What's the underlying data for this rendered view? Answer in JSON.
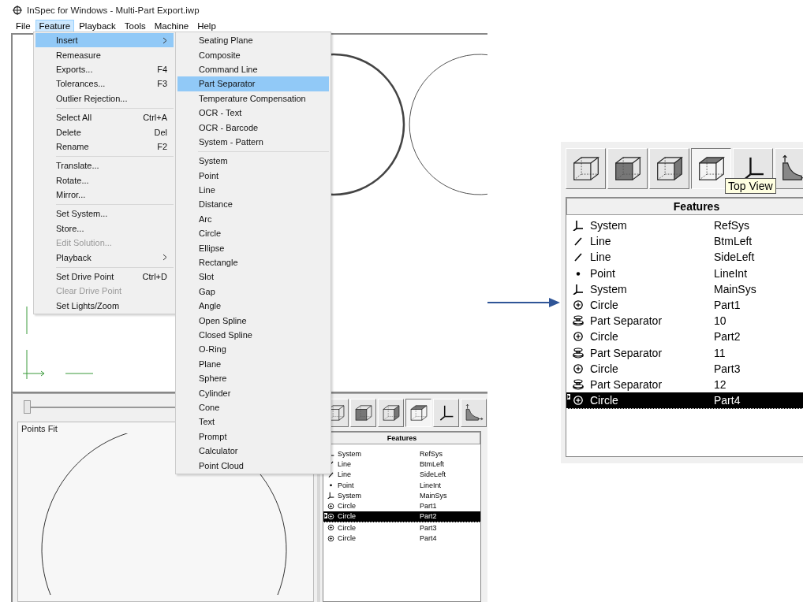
{
  "window": {
    "title": "InSpec for Windows - Multi-Part Export.iwp"
  },
  "menu_bar": [
    {
      "label": "File",
      "selected": false
    },
    {
      "label": "Feature",
      "selected": true
    },
    {
      "label": "Playback",
      "selected": false
    },
    {
      "label": "Tools",
      "selected": false
    },
    {
      "label": "Machine",
      "selected": false
    },
    {
      "label": "Help",
      "selected": false
    }
  ],
  "feature_menu": [
    {
      "kind": "item",
      "label": "Insert",
      "has_submenu": true,
      "selected": true,
      "disabled": false
    },
    {
      "kind": "item",
      "label": "Remeasure",
      "has_submenu": false,
      "selected": false,
      "disabled": false
    },
    {
      "kind": "item",
      "label": "Exports...",
      "shortcut": "F4",
      "has_submenu": false,
      "selected": false,
      "disabled": false
    },
    {
      "kind": "item",
      "label": "Tolerances...",
      "shortcut": "F3",
      "has_submenu": false,
      "selected": false,
      "disabled": false
    },
    {
      "kind": "item",
      "label": "Outlier Rejection...",
      "has_submenu": false,
      "selected": false,
      "disabled": false
    },
    {
      "kind": "separator"
    },
    {
      "kind": "item",
      "label": "Select All",
      "shortcut": "Ctrl+A",
      "has_submenu": false,
      "selected": false,
      "disabled": false
    },
    {
      "kind": "item",
      "label": "Delete",
      "shortcut": "Del",
      "has_submenu": false,
      "selected": false,
      "disabled": false
    },
    {
      "kind": "item",
      "label": "Rename",
      "shortcut": "F2",
      "has_submenu": false,
      "selected": false,
      "disabled": false
    },
    {
      "kind": "separator"
    },
    {
      "kind": "item",
      "label": "Translate...",
      "has_submenu": false,
      "selected": false,
      "disabled": false
    },
    {
      "kind": "item",
      "label": "Rotate...",
      "has_submenu": false,
      "selected": false,
      "disabled": false
    },
    {
      "kind": "item",
      "label": "Mirror...",
      "has_submenu": false,
      "selected": false,
      "disabled": false
    },
    {
      "kind": "separator"
    },
    {
      "kind": "item",
      "label": "Set System...",
      "has_submenu": false,
      "selected": false,
      "disabled": false
    },
    {
      "kind": "item",
      "label": "Store...",
      "has_submenu": false,
      "selected": false,
      "disabled": false
    },
    {
      "kind": "item",
      "label": "Edit Solution...",
      "has_submenu": false,
      "selected": false,
      "disabled": true
    },
    {
      "kind": "item",
      "label": "Playback",
      "has_submenu": true,
      "selected": false,
      "disabled": false
    },
    {
      "kind": "separator"
    },
    {
      "kind": "item",
      "label": "Set Drive Point",
      "shortcut": "Ctrl+D",
      "has_submenu": false,
      "selected": false,
      "disabled": false
    },
    {
      "kind": "item",
      "label": "Clear Drive Point",
      "has_submenu": false,
      "selected": false,
      "disabled": true
    },
    {
      "kind": "item",
      "label": "Set Lights/Zoom",
      "has_submenu": false,
      "selected": false,
      "disabled": false
    }
  ],
  "insert_submenu": [
    {
      "kind": "item",
      "label": "Seating Plane",
      "selected": false
    },
    {
      "kind": "item",
      "label": "Composite",
      "selected": false
    },
    {
      "kind": "item",
      "label": "Command Line",
      "selected": false
    },
    {
      "kind": "item",
      "label": "Part Separator",
      "selected": true
    },
    {
      "kind": "item",
      "label": "Temperature Compensation",
      "selected": false
    },
    {
      "kind": "item",
      "label": "OCR - Text",
      "selected": false
    },
    {
      "kind": "item",
      "label": "OCR - Barcode",
      "selected": false
    },
    {
      "kind": "item",
      "label": "System - Pattern",
      "selected": false
    },
    {
      "kind": "separator"
    },
    {
      "kind": "item",
      "label": "System",
      "selected": false
    },
    {
      "kind": "item",
      "label": "Point",
      "selected": false
    },
    {
      "kind": "item",
      "label": "Line",
      "selected": false
    },
    {
      "kind": "item",
      "label": "Distance",
      "selected": false
    },
    {
      "kind": "item",
      "label": "Arc",
      "selected": false
    },
    {
      "kind": "item",
      "label": "Circle",
      "selected": false
    },
    {
      "kind": "item",
      "label": "Ellipse",
      "selected": false
    },
    {
      "kind": "item",
      "label": "Rectangle",
      "selected": false
    },
    {
      "kind": "item",
      "label": "Slot",
      "selected": false
    },
    {
      "kind": "item",
      "label": "Gap",
      "selected": false
    },
    {
      "kind": "item",
      "label": "Angle",
      "selected": false
    },
    {
      "kind": "item",
      "label": "Open Spline",
      "selected": false
    },
    {
      "kind": "item",
      "label": "Closed Spline",
      "selected": false
    },
    {
      "kind": "item",
      "label": "O-Ring",
      "selected": false
    },
    {
      "kind": "item",
      "label": "Plane",
      "selected": false
    },
    {
      "kind": "item",
      "label": "Sphere",
      "selected": false
    },
    {
      "kind": "item",
      "label": "Cylinder",
      "selected": false
    },
    {
      "kind": "item",
      "label": "Cone",
      "selected": false
    },
    {
      "kind": "item",
      "label": "Text",
      "selected": false
    },
    {
      "kind": "item",
      "label": "Prompt",
      "selected": false
    },
    {
      "kind": "item",
      "label": "Calculator",
      "selected": false
    },
    {
      "kind": "item",
      "label": "Point Cloud",
      "selected": false
    }
  ],
  "bottom_panel": {
    "slider": {
      "level": 0
    },
    "plot_title": "Points Fit"
  },
  "view_toolbar": [
    {
      "kind": "iso",
      "selected": false
    },
    {
      "kind": "front",
      "selected": false
    },
    {
      "kind": "right",
      "selected": false
    },
    {
      "kind": "top",
      "selected": true
    },
    {
      "kind": "axes",
      "selected": false
    },
    {
      "kind": "profile",
      "selected": false
    }
  ],
  "features_table": {
    "header": "Features",
    "rows": [
      {
        "kind": "system",
        "type": "System",
        "name": "RefSys",
        "selected": false
      },
      {
        "kind": "line",
        "type": "Line",
        "name": "BtmLeft",
        "selected": false
      },
      {
        "kind": "line",
        "type": "Line",
        "name": "SideLeft",
        "selected": false
      },
      {
        "kind": "point",
        "type": "Point",
        "name": "LineInt",
        "selected": false
      },
      {
        "kind": "system",
        "type": "System",
        "name": "MainSys",
        "selected": false
      },
      {
        "kind": "circle",
        "type": "Circle",
        "name": "Part1",
        "selected": false
      },
      {
        "kind": "circle",
        "type": "Circle",
        "name": "Part2",
        "selected": true
      },
      {
        "kind": "circle",
        "type": "Circle",
        "name": "Part3",
        "selected": false
      },
      {
        "kind": "circle",
        "type": "Circle",
        "name": "Part4",
        "selected": false
      }
    ]
  },
  "zoom_inset": {
    "view_toolbar": [
      {
        "kind": "iso",
        "selected": false
      },
      {
        "kind": "front",
        "selected": false
      },
      {
        "kind": "right",
        "selected": false
      },
      {
        "kind": "top",
        "selected": true
      },
      {
        "kind": "axes",
        "selected": false
      },
      {
        "kind": "profile",
        "selected": false
      }
    ],
    "tooltip": "Top View",
    "features_table": {
      "header": "Features",
      "rows": [
        {
          "kind": "system",
          "type": "System",
          "name": "RefSys",
          "selected": false
        },
        {
          "kind": "line",
          "type": "Line",
          "name": "BtmLeft",
          "selected": false
        },
        {
          "kind": "line",
          "type": "Line",
          "name": "SideLeft",
          "selected": false
        },
        {
          "kind": "point",
          "type": "Point",
          "name": "LineInt",
          "selected": false
        },
        {
          "kind": "system",
          "type": "System",
          "name": "MainSys",
          "selected": false
        },
        {
          "kind": "circle",
          "type": "Circle",
          "name": "Part1",
          "selected": false
        },
        {
          "kind": "separator",
          "type": "Part Separator",
          "name": "10",
          "selected": false
        },
        {
          "kind": "circle",
          "type": "Circle",
          "name": "Part2",
          "selected": false
        },
        {
          "kind": "separator",
          "type": "Part Separator",
          "name": "11",
          "selected": false
        },
        {
          "kind": "circle",
          "type": "Circle",
          "name": "Part3",
          "selected": false
        },
        {
          "kind": "separator",
          "type": "Part Separator",
          "name": "12",
          "selected": false
        },
        {
          "kind": "circle",
          "type": "Circle",
          "name": "Part4",
          "selected": true
        }
      ]
    }
  }
}
